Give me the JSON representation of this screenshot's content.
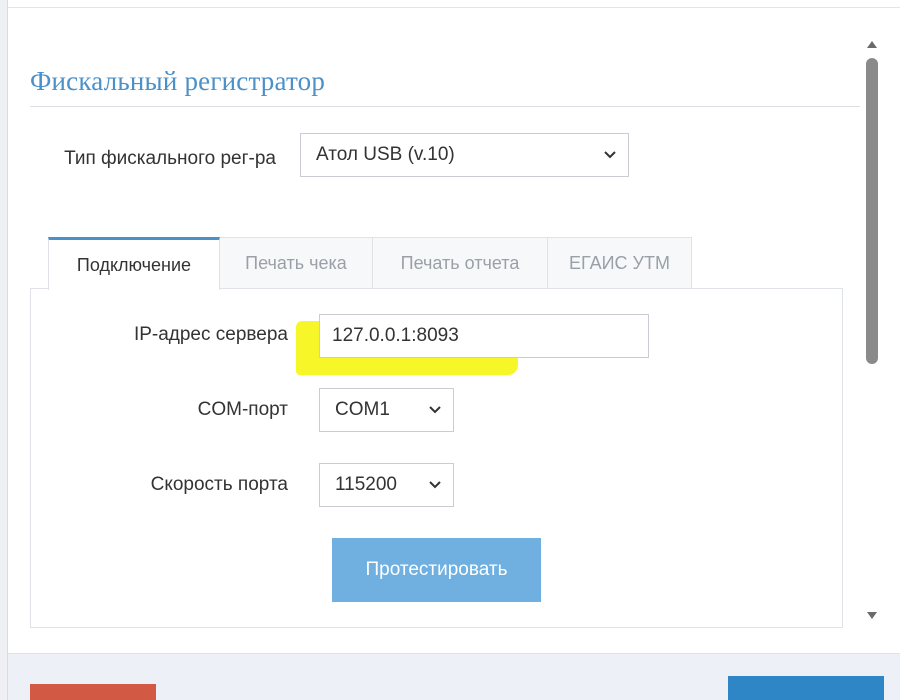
{
  "section": {
    "title": "Фискальный регистратор"
  },
  "register_type": {
    "label": "Тип фискального рег-ра",
    "selected": "Атол USB (v.10)"
  },
  "tabs": [
    {
      "label": "Подключение",
      "active": true
    },
    {
      "label": "Печать чека",
      "active": false
    },
    {
      "label": "Печать отчета",
      "active": false
    },
    {
      "label": "ЕГАИС УТМ",
      "active": false
    }
  ],
  "connection": {
    "ip_label": "IP-адрес сервера",
    "ip_value": "127.0.0.1:8093",
    "com_label": "COM-порт",
    "com_selected": "COM1",
    "speed_label": "Скорость порта",
    "speed_selected": "115200",
    "test_button": "Протестировать"
  },
  "colors": {
    "accent": "#4a90c9",
    "test_button": "#6fb0e0",
    "highlight": "#f7f51c",
    "footer_left_button": "#d25a45",
    "footer_right_button": "#2f86c7"
  },
  "icons": {
    "select_arrow": "chevron-down-icon",
    "scroll_up": "triangle-up-icon",
    "scroll_down": "triangle-down-icon"
  }
}
